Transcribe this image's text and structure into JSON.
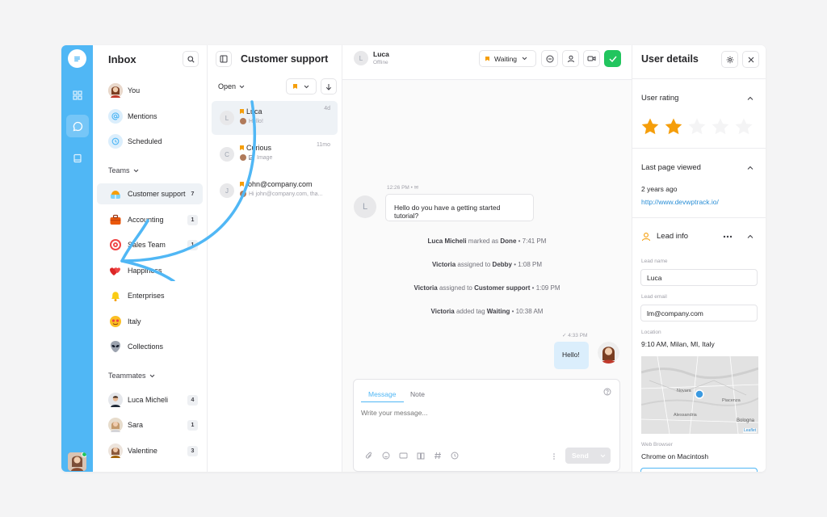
{
  "rail": {
    "accent": "#50b7f5"
  },
  "inbox": {
    "title": "Inbox",
    "top_items": [
      {
        "label": "You"
      },
      {
        "label": "Mentions"
      },
      {
        "label": "Scheduled"
      }
    ],
    "teams_header": "Teams",
    "teams": [
      {
        "label": "Customer support",
        "count": "7"
      },
      {
        "label": "Accounting",
        "count": "1"
      },
      {
        "label": "Sales Team",
        "count": "1"
      },
      {
        "label": "Happiness",
        "count": ""
      },
      {
        "label": "Enterprises",
        "count": ""
      },
      {
        "label": "Italy",
        "count": ""
      },
      {
        "label": "Collections",
        "count": ""
      }
    ],
    "teammates_header": "Teammates",
    "teammates": [
      {
        "label": "Luca Micheli",
        "count": "4"
      },
      {
        "label": "Sara",
        "count": "1"
      },
      {
        "label": "Valentine",
        "count": "3"
      }
    ]
  },
  "conversations": {
    "title": "Customer support",
    "filter": "Open",
    "items": [
      {
        "initial": "L",
        "name": "Luca",
        "preview": "Hello!",
        "time": "4d"
      },
      {
        "initial": "C",
        "name": "Curious",
        "preview": "Image",
        "time": "11mo"
      },
      {
        "initial": "J",
        "name": "john@company.com",
        "preview": "Hi john@company.com, tha...",
        "time": ""
      }
    ]
  },
  "chat": {
    "contact_initial": "L",
    "contact_name": "Luca",
    "contact_status": "Offline",
    "status_dropdown": "Waiting",
    "incoming": {
      "time": "12:26 PM",
      "text": "Hello do you have a getting started tutorial?",
      "avatar": "L"
    },
    "events": [
      {
        "actor": "Luca Micheli",
        "action": "marked as",
        "target": "Done",
        "time": "7:41 PM"
      },
      {
        "actor": "Victoria",
        "action": "assigned to",
        "target": "Debby",
        "time": "1:08 PM"
      },
      {
        "actor": "Victoria",
        "action": "assigned to",
        "target": "Customer support",
        "time": "1:09 PM"
      },
      {
        "actor": "Victoria",
        "action": "added tag",
        "target": "Waiting",
        "time": "10:38 AM"
      }
    ],
    "outgoing": {
      "time": "4:33 PM",
      "text": "Hello!"
    },
    "composer": {
      "tab_message": "Message",
      "tab_note": "Note",
      "placeholder": "Write your message...",
      "send_label": "Send"
    }
  },
  "details": {
    "title": "User details",
    "rating_title": "User rating",
    "rating": 2,
    "rating_max": 5,
    "last_page_title": "Last page viewed",
    "last_page_time": "2 years ago",
    "last_page_url": "http://www.devwptrack.io/",
    "lead_title": "Lead info",
    "lead_name_label": "Lead name",
    "lead_name": "Luca",
    "lead_email_label": "Lead email",
    "lead_email": "lm@company.com",
    "location_label": "Location",
    "location": "9:10 AM, Milan, MI, Italy",
    "map_label_1": "Novara",
    "map_label_2": "Piacenza",
    "map_label_3": "Bologna",
    "map_label_4": "Alessandria",
    "map_label_5": "Leaflet",
    "browser_label": "Web Browser",
    "browser": "Chrome on Macintosh"
  }
}
